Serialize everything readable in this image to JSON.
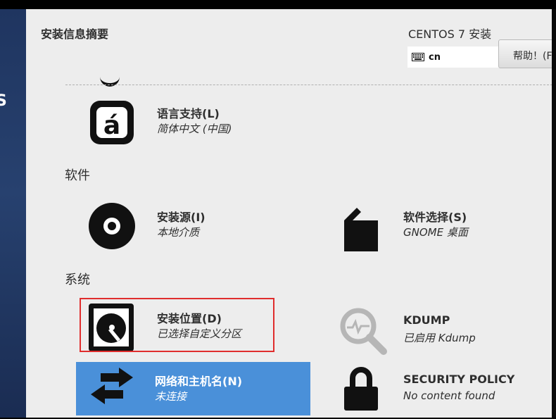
{
  "sidebar": {
    "brand_text": "S"
  },
  "header": {
    "page_title": "安装信息摘要",
    "product_title": "CENTOS 7 安装",
    "keyboard_layout": "cn",
    "help_label": "帮助！(F"
  },
  "categories": {
    "software": "软件",
    "system": "系统"
  },
  "spokes": {
    "language": {
      "title": "语言支持(L)",
      "status": "简体中文 (中国)",
      "icon": "language-icon"
    },
    "source": {
      "title": "安装源(I)",
      "status": "本地介质",
      "icon": "disc-icon"
    },
    "software": {
      "title": "软件选择(S)",
      "status": "GNOME 桌面",
      "icon": "package-icon"
    },
    "storage": {
      "title": "安装位置(D)",
      "status": "已选择自定义分区",
      "icon": "harddisk-icon"
    },
    "kdump": {
      "title": "KDUMP",
      "status": "已启用 Kdump",
      "icon": "magnifier-icon"
    },
    "network": {
      "title": "网络和主机名(N)",
      "status": "未连接",
      "icon": "network-arrows-icon"
    },
    "security": {
      "title": "SECURITY POLICY",
      "status": "No content found",
      "icon": "lock-icon"
    }
  },
  "colors": {
    "selected_bg": "#4a90d9",
    "highlight_border": "#e02d2d",
    "sidebar_bg": "#27416f"
  }
}
